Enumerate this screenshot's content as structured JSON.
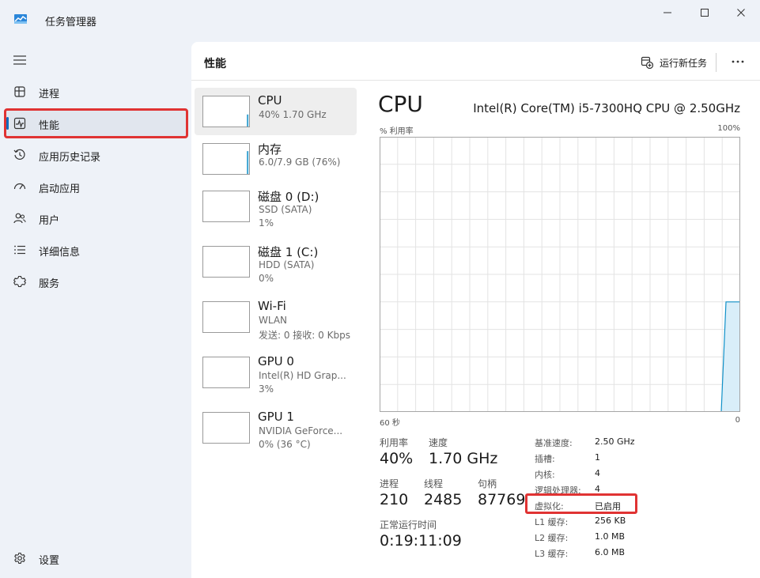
{
  "window": {
    "title": "任务管理器",
    "controls": {
      "minimize": "minimize-icon",
      "maximize": "maximize-icon",
      "close": "close-icon"
    }
  },
  "sidebar": {
    "menu_icon": "hamburger-icon",
    "items": [
      {
        "label": "进程",
        "icon": "processes-icon"
      },
      {
        "label": "性能",
        "icon": "performance-icon",
        "active": true
      },
      {
        "label": "应用历史记录",
        "icon": "history-icon"
      },
      {
        "label": "启动应用",
        "icon": "startup-icon"
      },
      {
        "label": "用户",
        "icon": "users-icon"
      },
      {
        "label": "详细信息",
        "icon": "details-icon"
      },
      {
        "label": "服务",
        "icon": "services-icon"
      }
    ],
    "settings": {
      "label": "设置",
      "icon": "gear-icon"
    }
  },
  "header": {
    "title": "性能",
    "run_task": "运行新任务",
    "more": "more-icon"
  },
  "devices": [
    {
      "name": "CPU",
      "sub1": "40%  1.70 GHz",
      "sub2": "",
      "selected": true,
      "usage": 0.4
    },
    {
      "name": "内存",
      "sub1": "6.0/7.9 GB (76%)",
      "sub2": "",
      "usage": 0.76
    },
    {
      "name": "磁盘 0 (D:)",
      "sub1": "SSD (SATA)",
      "sub2": "1%",
      "usage": 0.01
    },
    {
      "name": "磁盘 1 (C:)",
      "sub1": "HDD (SATA)",
      "sub2": "0%",
      "usage": 0
    },
    {
      "name": "Wi-Fi",
      "sub1": "WLAN",
      "sub2": "发送: 0 接收: 0 Kbps",
      "usage": 0
    },
    {
      "name": "GPU 0",
      "sub1": "Intel(R) HD Grap...",
      "sub2": "3%",
      "usage": 0.03
    },
    {
      "name": "GPU 1",
      "sub1": "NVIDIA GeForce...",
      "sub2": "0% (36 °C)",
      "usage": 0
    }
  ],
  "detail": {
    "title": "CPU",
    "model": "Intel(R) Core(TM) i5-7300HQ CPU @ 2.50GHz",
    "graph": {
      "y_label": "% 利用率",
      "y_max_label": "100%",
      "x_left_label": "60 秒",
      "x_right_label": "0",
      "recent_usage": 0.4,
      "colors": {
        "line": "#1191c8",
        "fill": "#d9eef9",
        "grid": "#e3e3e3",
        "border": "#a6a6a6"
      }
    },
    "stats": {
      "utilization_label": "利用率",
      "utilization": "40%",
      "speed_label": "速度",
      "speed": "1.70 GHz",
      "processes_label": "进程",
      "processes": "210",
      "threads_label": "线程",
      "threads": "2485",
      "handles_label": "句柄",
      "handles": "87769",
      "uptime_label": "正常运行时间",
      "uptime": "0:19:11:09"
    },
    "specs": [
      {
        "label": "基准速度:",
        "value": "2.50 GHz"
      },
      {
        "label": "插槽:",
        "value": "1"
      },
      {
        "label": "内核:",
        "value": "4"
      },
      {
        "label": "逻辑处理器:",
        "value": "4"
      },
      {
        "label": "虚拟化:",
        "value": "已启用"
      },
      {
        "label": "L1 缓存:",
        "value": "256 KB"
      },
      {
        "label": "L2 缓存:",
        "value": "1.0 MB"
      },
      {
        "label": "L3 缓存:",
        "value": "6.0 MB"
      }
    ]
  },
  "colors": {
    "accent": "#0f6cbd",
    "highlight": "#e03333"
  }
}
